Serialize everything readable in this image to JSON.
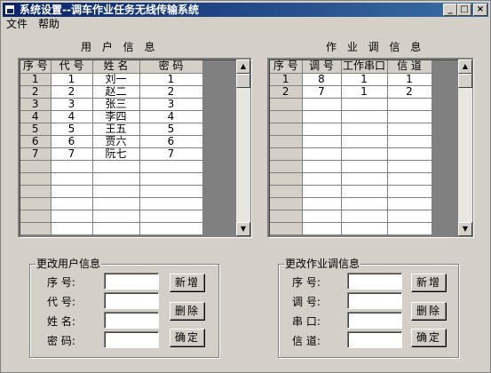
{
  "window": {
    "title": "系统设置--调车作业任务无线传输系统",
    "controls": {
      "minimize": "_",
      "maximize": "□",
      "close": "×"
    }
  },
  "menu": {
    "items": [
      "文件",
      "帮助"
    ]
  },
  "users": {
    "caption": "用 户 信 息",
    "columns": [
      "序 号",
      "代 号",
      "姓  名",
      "密    码"
    ],
    "rows": [
      [
        "1",
        "1",
        "刘一",
        "1"
      ],
      [
        "2",
        "2",
        "赵二",
        "2"
      ],
      [
        "3",
        "3",
        "张三",
        "3"
      ],
      [
        "4",
        "4",
        "李四",
        "4"
      ],
      [
        "5",
        "5",
        "王五",
        "5"
      ],
      [
        "6",
        "6",
        "贾六",
        "6"
      ],
      [
        "7",
        "7",
        "阮七",
        "7"
      ]
    ]
  },
  "jobs": {
    "caption": "作 业 调 信 息",
    "columns": [
      "序 号",
      "调 号",
      "工作串口",
      "信 道"
    ],
    "rows": [
      [
        "1",
        "8",
        "1",
        "1"
      ],
      [
        "2",
        "7",
        "1",
        "2"
      ]
    ]
  },
  "edit_user": {
    "legend": "更改用户信息",
    "labels": {
      "seq": "序 号:",
      "code": "代 号:",
      "name": "姓 名:",
      "password": "密 码:"
    },
    "values": {
      "seq": "",
      "code": "",
      "name": "",
      "password": ""
    },
    "buttons": {
      "add": "新增",
      "delete": "删除",
      "confirm": "确定"
    }
  },
  "edit_job": {
    "legend": "更改作业调信息",
    "labels": {
      "seq": "序 号:",
      "num": "调 号:",
      "port": "串 口:",
      "channel": "信 道:"
    },
    "values": {
      "seq": "",
      "num": "",
      "port": "",
      "channel": ""
    },
    "buttons": {
      "add": "新增",
      "delete": "删除",
      "confirm": "确定"
    }
  },
  "scroll_icons": {
    "up": "up-arrow-icon",
    "down": "down-arrow-icon"
  }
}
